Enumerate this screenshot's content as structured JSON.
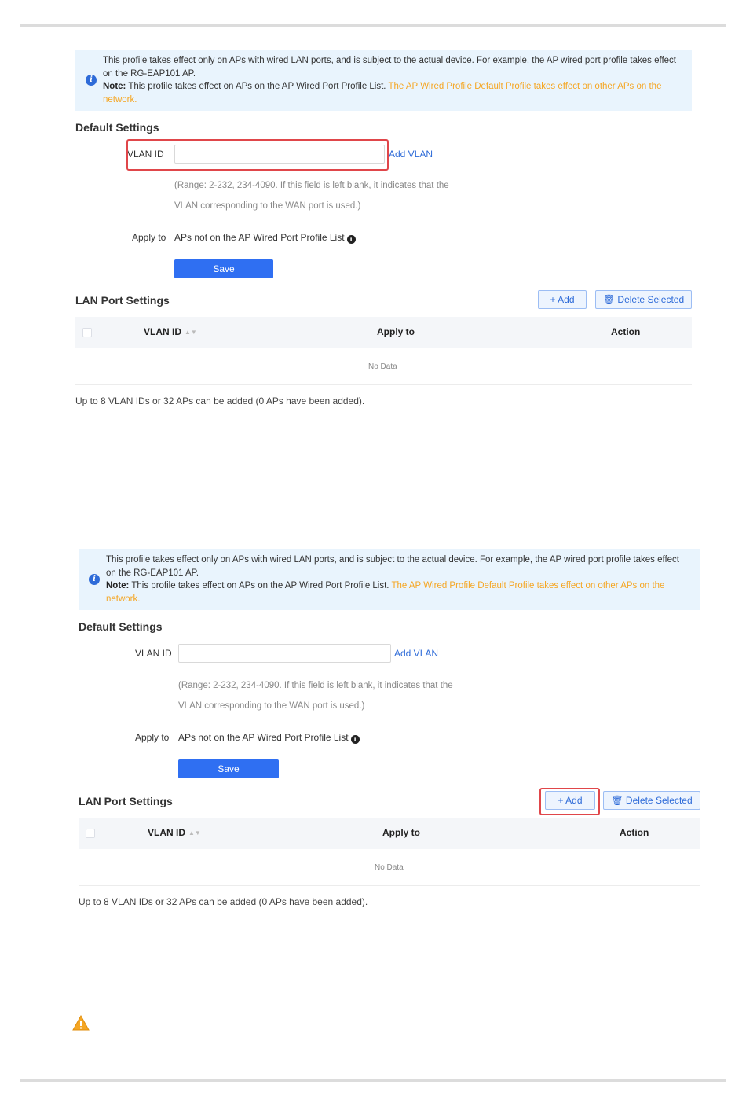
{
  "notice": {
    "line1": "This profile takes effect only on APs with wired LAN ports, and is subject to the actual device. For example, the AP wired port profile takes effect on the RG-EAP101 AP.",
    "note_label": "Note:",
    "note_text": " This profile takes effect on APs on the AP Wired Port Profile List. ",
    "note_orange": "The AP Wired Profile Default Profile takes effect on other APs on the network."
  },
  "default_settings": {
    "title": "Default Settings",
    "vlan_label": "VLAN ID",
    "vlan_value": "",
    "add_vlan": "Add VLAN",
    "hint_line1": "(Range: 2-232, 234-4090. If this field is left blank, it indicates that the",
    "hint_line2": "VLAN corresponding to the WAN port is used.)",
    "apply_label": "Apply to",
    "apply_value": "APs not on the AP Wired Port Profile List",
    "save": "Save"
  },
  "lan_settings": {
    "title": "LAN Port Settings",
    "add": "+ Add",
    "delete_selected": "Delete Selected",
    "columns": [
      "VLAN ID",
      "Apply to",
      "Action"
    ],
    "no_data": "No Data",
    "footnote": "Up to 8 VLAN IDs or 32 APs can be added (0 APs have been added)."
  },
  "icons": {
    "info": "info-icon",
    "tip": "info-tip-icon",
    "trash": "trash-icon",
    "sort": "sort-icon",
    "warning": "warning-icon"
  },
  "colors": {
    "primary": "#2f6ff2",
    "highlight": "#e0464a",
    "notice_bg": "#e9f4fd",
    "orange_text": "#f5a623"
  }
}
